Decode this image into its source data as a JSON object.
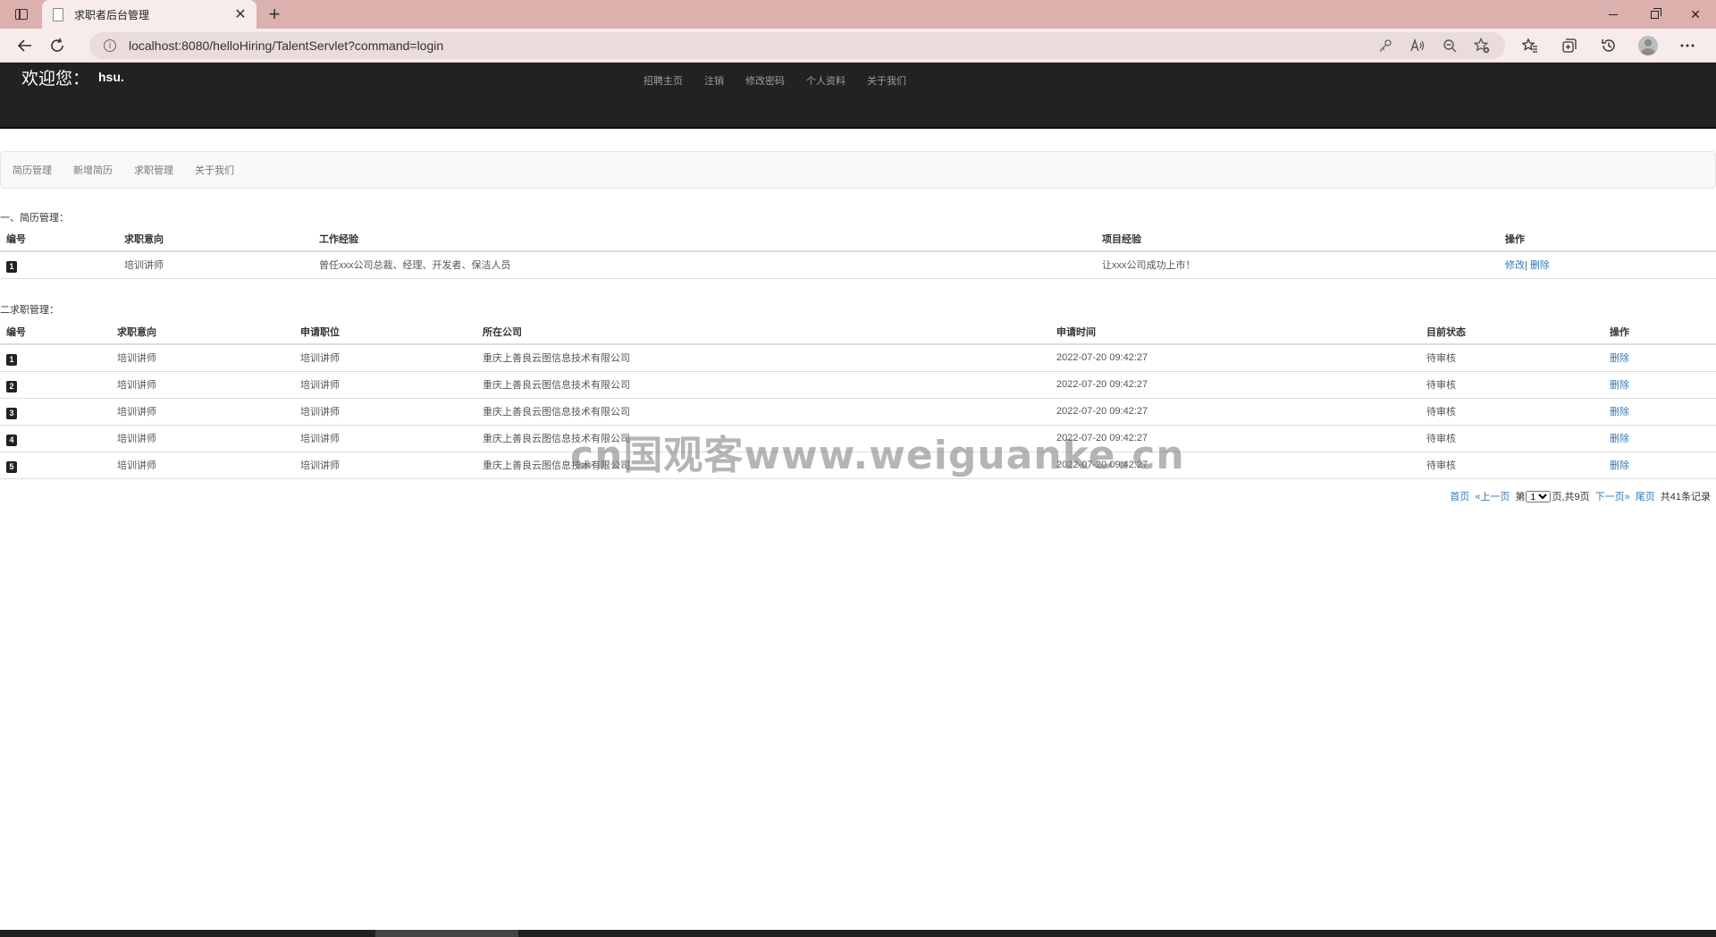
{
  "browser": {
    "tab_title": "求职者后台管理",
    "url": "localhost:8080/helloHiring/TalentServlet?command=login",
    "new_tab_glyph": "+",
    "close_glyph": "✕"
  },
  "header": {
    "welcome": "欢迎您：",
    "username": "hsu.",
    "nav": [
      "招聘主页",
      "注销",
      "修改密码",
      "个人资料",
      "关于我们"
    ]
  },
  "subnav": [
    "简历管理",
    "新增简历",
    "求职管理",
    "关于我们"
  ],
  "resume_section": {
    "title": "一、简历管理：",
    "columns": [
      "编号",
      "求职意向",
      "工作经验",
      "项目经验",
      "操作"
    ],
    "rows": [
      {
        "id": "1",
        "intent": "培训讲师",
        "experience": "曾任xxx公司总裁、经理、开发者、保洁人员",
        "project": "让xxx公司成功上市！",
        "edit": "修改",
        "sep": "|",
        "delete": "删除"
      }
    ]
  },
  "application_section": {
    "title": "二求职管理：",
    "columns": [
      "编号",
      "求职意向",
      "申请职位",
      "所在公司",
      "申请时间",
      "目前状态",
      "操作"
    ],
    "rows": [
      {
        "id": "1",
        "intent": "培训讲师",
        "position": "培训讲师",
        "company": "重庆上善良云图信息技术有限公司",
        "time": "2022-07-20 09:42:27",
        "status": "待审核",
        "action": "删除"
      },
      {
        "id": "2",
        "intent": "培训讲师",
        "position": "培训讲师",
        "company": "重庆上善良云图信息技术有限公司",
        "time": "2022-07-20 09:42:27",
        "status": "待审核",
        "action": "删除"
      },
      {
        "id": "3",
        "intent": "培训讲师",
        "position": "培训讲师",
        "company": "重庆上善良云图信息技术有限公司",
        "time": "2022-07-20 09:42:27",
        "status": "待审核",
        "action": "删除"
      },
      {
        "id": "4",
        "intent": "培训讲师",
        "position": "培训讲师",
        "company": "重庆上善良云图信息技术有限公司",
        "time": "2022-07-20 09:42:27",
        "status": "待审核",
        "action": "删除"
      },
      {
        "id": "5",
        "intent": "培训讲师",
        "position": "培训讲师",
        "company": "重庆上善良云图信息技术有限公司",
        "time": "2022-07-20 09:42:27",
        "status": "待审核",
        "action": "删除"
      }
    ]
  },
  "pager": {
    "first": "首页",
    "prev": "«上一页",
    "page_prefix": "第",
    "current_page": "1",
    "page_suffix": "页",
    "total_pages": ",共9页",
    "next": "下一页»",
    "last": "尾页",
    "total_records": "共41条记录"
  },
  "watermark": "cn国观客www.weiguanke.cn"
}
